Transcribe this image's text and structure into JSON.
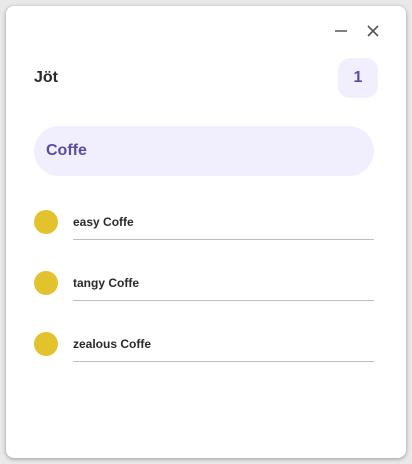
{
  "app": {
    "title": "Jöt",
    "count": "1"
  },
  "window_controls": {
    "minimize_icon": "minimize-icon",
    "close_icon": "close-icon"
  },
  "search": {
    "value": "Coffe",
    "placeholder": ""
  },
  "items": [
    {
      "label": "easy Coffe"
    },
    {
      "label": "tangy Coffe"
    },
    {
      "label": "zealous Coffe"
    }
  ],
  "colors": {
    "accent": "#5a4ea0",
    "accent_bg": "#f1effd",
    "bullet": "#e2c22d"
  }
}
